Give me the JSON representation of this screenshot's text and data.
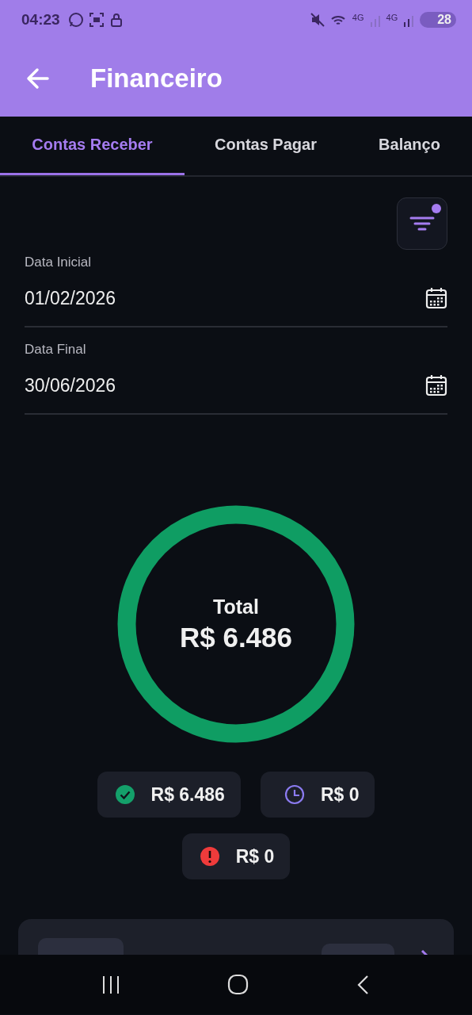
{
  "status_bar": {
    "time": "04:23",
    "network_1": "4G",
    "network_2": "4G",
    "battery": "28"
  },
  "app_bar": {
    "title": "Financeiro"
  },
  "tabs": [
    {
      "label": "Contas Receber",
      "selected": true
    },
    {
      "label": "Contas Pagar",
      "selected": false
    },
    {
      "label": "Balanço",
      "selected": false
    }
  ],
  "filter": {
    "active": true
  },
  "fields": [
    {
      "label": "Data Inicial",
      "value": "01/02/2026"
    },
    {
      "label": "Data Final",
      "value": "30/06/2026"
    }
  ],
  "total": {
    "label": "Total",
    "value": "R$ 6.486"
  },
  "summary": [
    {
      "kind": "paid",
      "amount": "R$ 6.486"
    },
    {
      "kind": "pending",
      "amount": "R$ 0"
    },
    {
      "kind": "overdue",
      "amount": "R$ 0"
    }
  ]
}
